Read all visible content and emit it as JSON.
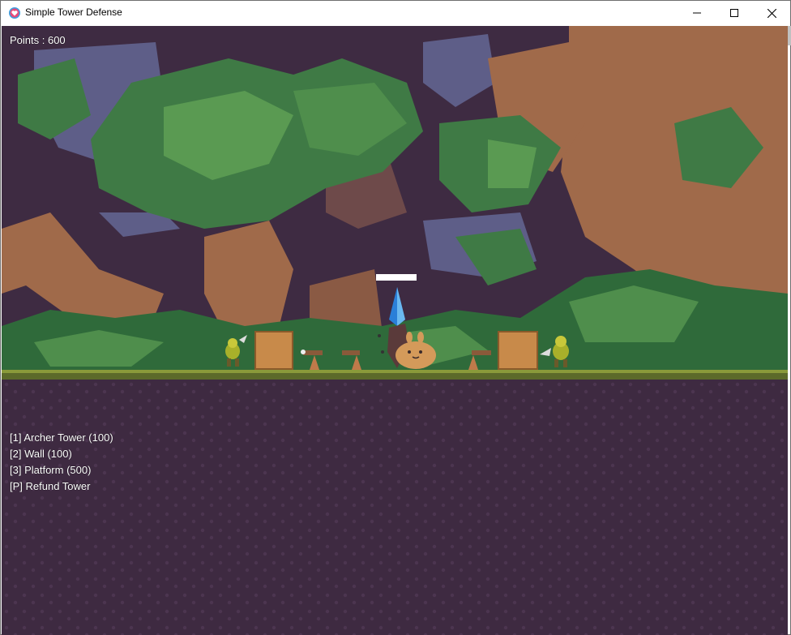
{
  "window": {
    "title": "Simple Tower Defense"
  },
  "hud": {
    "points": "Points : 600"
  },
  "menu": {
    "items": [
      {
        "label": "[1] Archer Tower (100)"
      },
      {
        "label": "[2] Wall (100)"
      },
      {
        "label": "[3] Platform (500)"
      },
      {
        "label": "[P] Refund Tower"
      }
    ]
  },
  "colors": {
    "soil": "#3e2a41",
    "grass": "#7a8a3a",
    "crate": "#c88a4a",
    "crystal": "#2a7fd8",
    "slime": "#d49a5a",
    "goblin": "#a8b02a"
  },
  "icons": {
    "app": "heart-icon",
    "minimize": "minimize-icon",
    "maximize": "maximize-icon",
    "close": "close-icon"
  }
}
